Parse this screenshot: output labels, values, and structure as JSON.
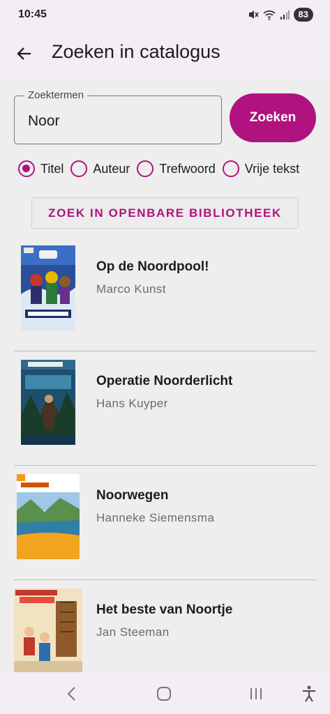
{
  "status": {
    "time": "10:45",
    "battery": "83"
  },
  "appbar": {
    "title": "Zoeken in catalogus"
  },
  "search": {
    "label": "Zoektermen",
    "value": "Noor",
    "button": "Zoeken"
  },
  "radios": [
    {
      "label": "Titel",
      "checked": true
    },
    {
      "label": "Auteur",
      "checked": false
    },
    {
      "label": "Trefwoord",
      "checked": false
    },
    {
      "label": "Vrije tekst",
      "checked": false
    }
  ],
  "library_button": "ZOEK IN OPENBARE BIBLIOTHEEK",
  "results": [
    {
      "title": "Op de Noordpool!",
      "author": "Marco Kunst"
    },
    {
      "title": "Operatie Noorderlicht",
      "author": "Hans Kuyper"
    },
    {
      "title": "Noorwegen",
      "author": "Hanneke Siemensma"
    },
    {
      "title": "Het beste van Noortje",
      "author": "Jan Steeman"
    }
  ],
  "colors": {
    "accent": "#b0127f",
    "background": "#eeeeee",
    "bar": "#f3eef5"
  }
}
